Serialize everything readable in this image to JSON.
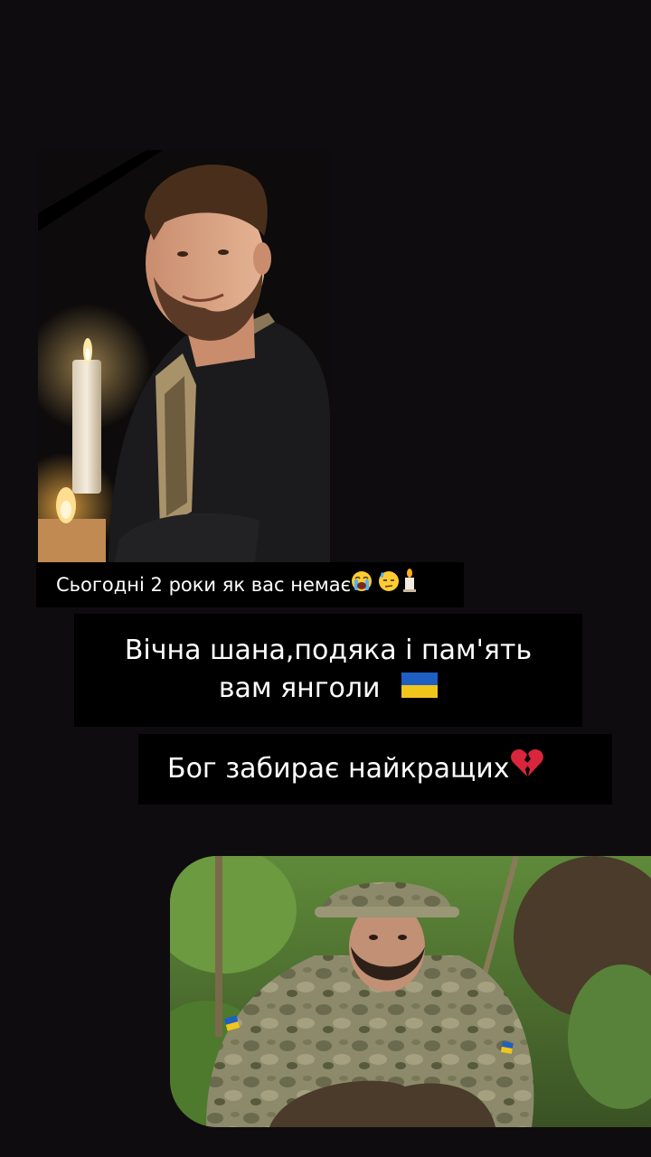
{
  "story": {
    "caption_1": "Сьогодні 2 роки як вас немає",
    "caption_1_emojis": [
      "loudly-crying-face-icon",
      "downcast-face-sweat-icon",
      "candle-icon"
    ],
    "caption_2_line1": "Вічна шана,подяка і пам'ять",
    "caption_2_line2": "вам янголи",
    "caption_2_emoji": "ukraine-flag-icon",
    "caption_3": "Бог забирає найкращих",
    "caption_3_emoji": "broken-heart-icon"
  },
  "colors": {
    "background": "#0f0c0f",
    "caption_bg": "#000000",
    "caption_text": "#ffffff",
    "flag_blue": "#1f5fc4",
    "flag_yellow": "#f2c51c",
    "heart_red": "#d9263c"
  }
}
